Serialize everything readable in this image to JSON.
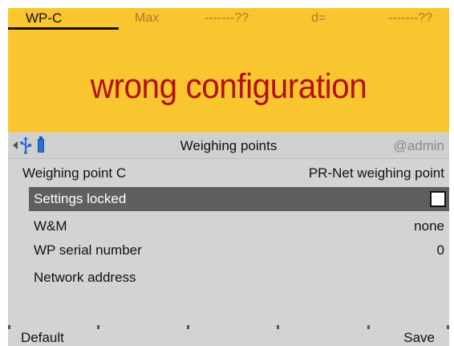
{
  "status": {
    "wp_name": "WP-C",
    "max_label": "Max",
    "max_value": "-------??",
    "d_label": "d=",
    "d_value": "-------??",
    "message": "wrong configuration"
  },
  "title_bar": {
    "back_icon": "left-arrow-icon",
    "usb_icon": "usb-icon",
    "battery_icon": "battery-icon",
    "title": "Weighing points",
    "user": "@admin"
  },
  "section": {
    "label": "Weighing point C",
    "value": "PR-Net weighing point"
  },
  "items": [
    {
      "label": "Settings locked",
      "value": "",
      "selected": true,
      "checkbox": false
    },
    {
      "label": "W&M",
      "value": "none"
    },
    {
      "label": "WP serial number",
      "value": "0"
    },
    {
      "label": "Network address",
      "value": ""
    }
  ],
  "softkeys": {
    "left": "Default",
    "right": "Save"
  },
  "colors": {
    "status_background": "#fac630",
    "error_text": "#b40f0f",
    "content_background": "#d3d3d3",
    "selected_row": "#5f5f5f"
  }
}
